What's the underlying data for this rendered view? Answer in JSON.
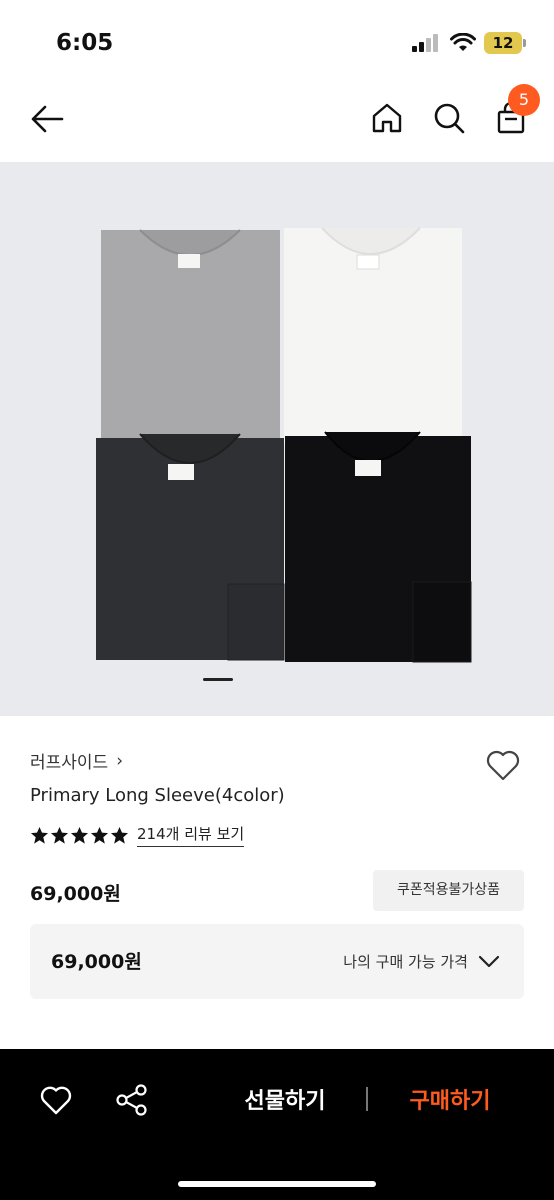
{
  "status_bar": {
    "time": "6:05",
    "battery": "12"
  },
  "cart": {
    "count": "5"
  },
  "product": {
    "brand": "러프사이드",
    "brand_chevron": "›",
    "name": "Primary Long Sleeve(4color)",
    "rating_stars": 5,
    "review_link": "214개 리뷰 보기",
    "price": "69,000원",
    "coupon_badge": "쿠폰적용불가상품",
    "my_price_value": "69,000원",
    "my_price_label": "나의 구매 가능 가격",
    "image_tag_text": "rough side",
    "image_shirt_colors": [
      "#a9a9ab",
      "#f5f5f3",
      "#2f3033",
      "#101012"
    ]
  },
  "bottom_bar": {
    "gift_label": "선물하기",
    "buy_label": "구매하기"
  },
  "colors": {
    "accent": "#ff5a1f",
    "hero_bg": "#e9eaee",
    "bottom_bar": "#000000"
  },
  "icons": [
    "back-arrow-icon",
    "home-icon",
    "search-icon",
    "shopping-bag-icon",
    "heart-icon",
    "star-icon",
    "chevron-down-icon",
    "share-icon"
  ]
}
